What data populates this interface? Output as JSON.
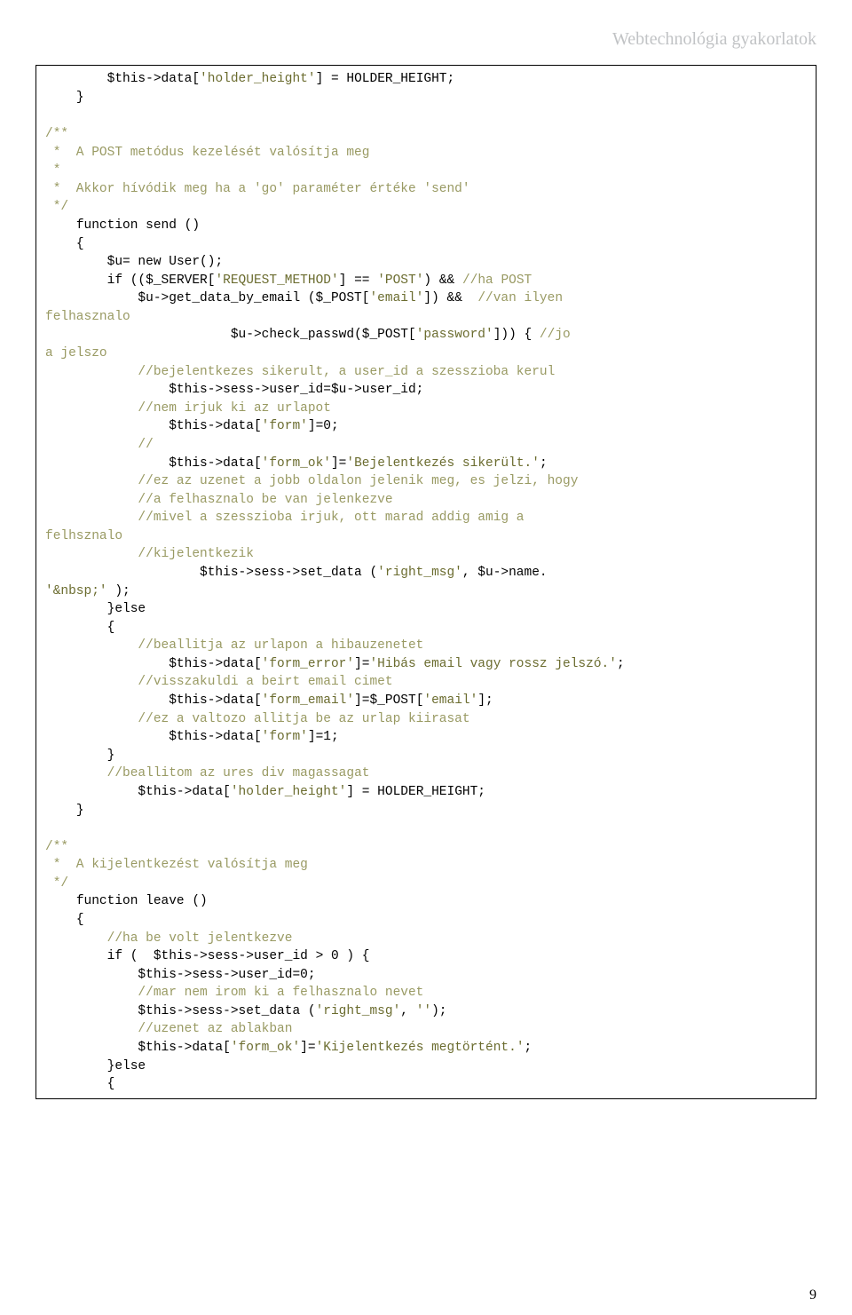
{
  "header": "Webtechnológia gyakorlatok",
  "page_number": "9",
  "code": {
    "l01": "        $this->data['holder_height'] = HOLDER_HEIGHT;",
    "l02": "    }",
    "l03": "",
    "l04": "/**",
    "l05": " *  A POST metódus kezelését valósítja meg",
    "l06": " *",
    "l07": " *  Akkor hívódik meg ha a 'go' paraméter értéke 'send'",
    "l08": " */",
    "l09": "    function send ()",
    "l10": "    {",
    "l11": "        $u= new User();",
    "l12": "        if (($_SERVER['REQUEST_METHOD'] == 'POST') && //ha POST",
    "l13": "            $u->get_data_by_email ($_POST['email']) &&  //van ilyen",
    "l14": "felhasznalo",
    "l15": "                        $u->check_passwd($_POST['password'])) { //jo",
    "l16": "a jelszo",
    "l17": "            //bejelentkezes sikerult, a user_id a szesszioba kerul",
    "l18": "                $this->sess->user_id=$u->user_id;",
    "l19": "            //nem irjuk ki az urlapot",
    "l20": "                $this->data['form']=0;",
    "l21": "            //",
    "l22": "                $this->data['form_ok']='Bejelentkezés sikerült.';",
    "l23": "            //ez az uzenet a jobb oldalon jelenik meg, es jelzi, hogy",
    "l24": "            //a felhasznalo be van jelenkezve",
    "l25": "            //mivel a szesszioba irjuk, ott marad addig amig a",
    "l26": "felhsznalo",
    "l27": "            //kijelentkezik",
    "l28": "                    $this->sess->set_data ('right_msg', $u->name.",
    "l29": "'&nbsp;' );",
    "l30": "        }else",
    "l31": "        {",
    "l32": "            //beallitja az urlapon a hibauzenetet",
    "l33": "                $this->data['form_error']='Hibás email vagy rossz jelszó.';",
    "l34": "            //visszakuldi a beirt email cimet",
    "l35": "                $this->data['form_email']=$_POST['email'];",
    "l36": "            //ez a valtozo allitja be az urlap kiirasat",
    "l37": "                $this->data['form']=1;",
    "l38": "        }",
    "l39": "        //beallitom az ures div magassagat",
    "l40": "            $this->data['holder_height'] = HOLDER_HEIGHT;",
    "l41": "    }",
    "l42": "",
    "l43": "/**",
    "l44": " *  A kijelentkezést valósítja meg",
    "l45": " */",
    "l46": "    function leave ()",
    "l47": "    {",
    "l48": "        //ha be volt jelentkezve",
    "l49": "        if (  $this->sess->user_id > 0 ) {",
    "l50": "            $this->sess->user_id=0;",
    "l51": "            //mar nem irom ki a felhasznalo nevet",
    "l52": "            $this->sess->set_data ('right_msg', '');",
    "l53": "            //uzenet az ablakban",
    "l54": "            $this->data['form_ok']='Kijelentkezés megtörtént.';",
    "l55": "        }else",
    "l56": "        {"
  }
}
